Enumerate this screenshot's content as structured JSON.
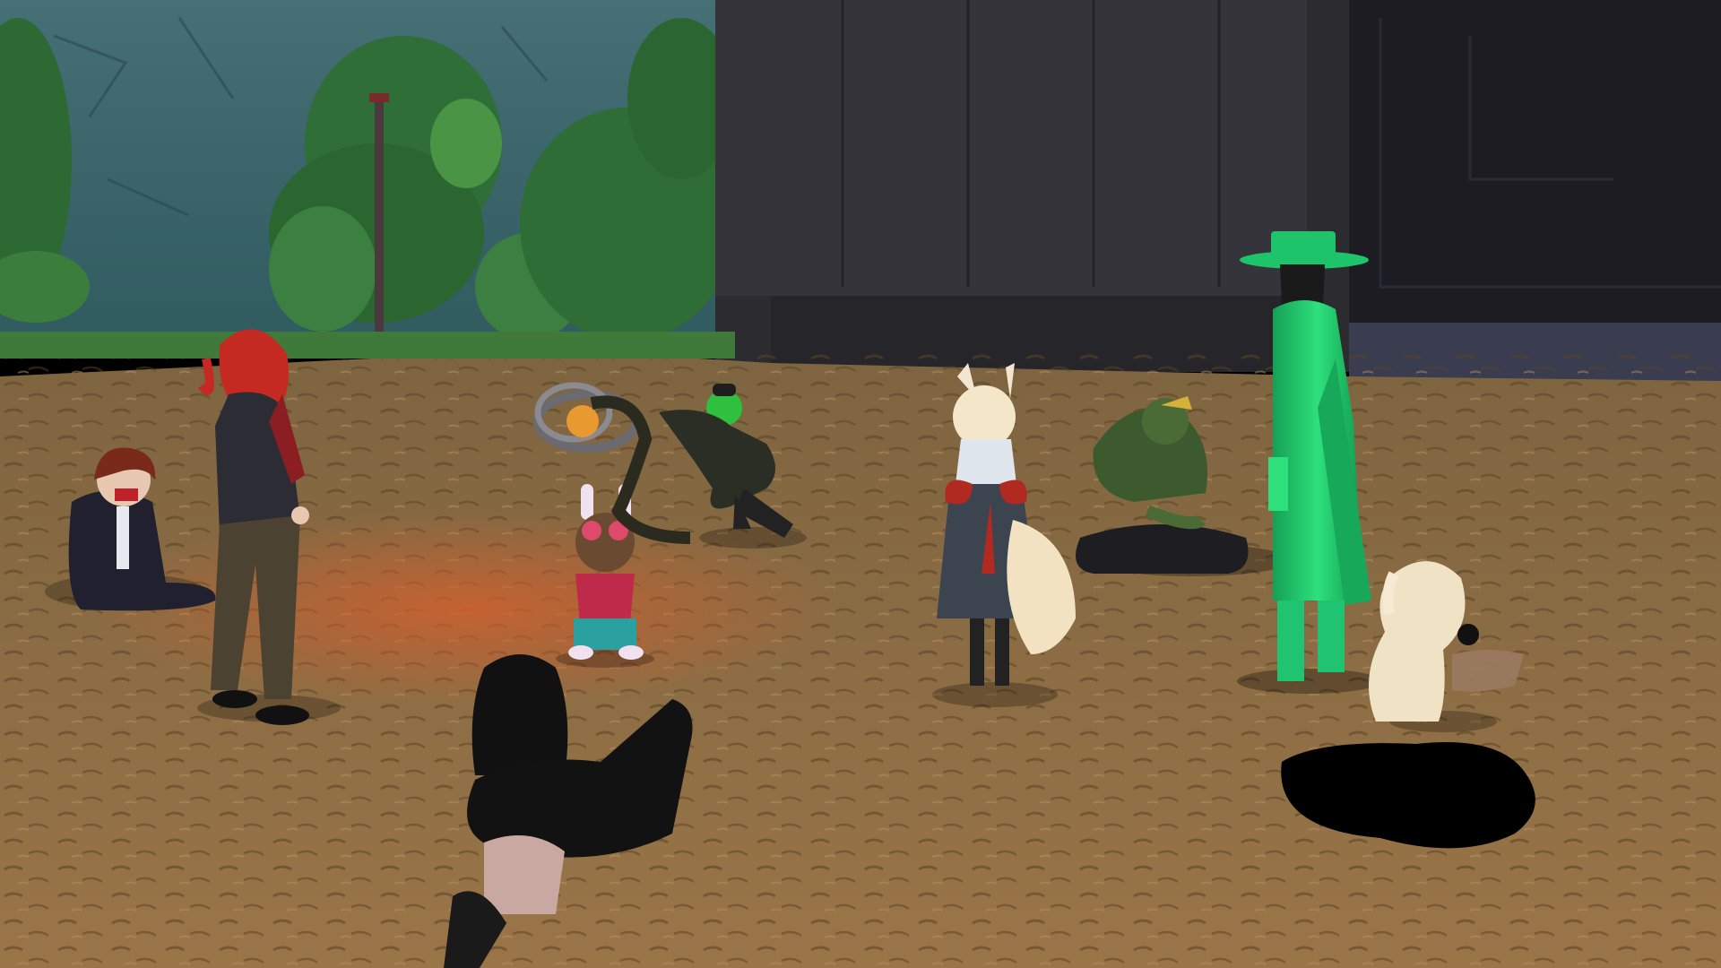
{
  "scene": {
    "description_free": true,
    "colors": {
      "sky_rock": "#3d6a72",
      "rock_dark": "#2f5258",
      "foliage": "#2f6a3a",
      "foliage_light": "#4f9a4a",
      "building": "#2b2b30",
      "building_light": "#3a3a40",
      "ground": "#8a6a3e",
      "ground_dark": "#5c4426",
      "glow": "#c0552a",
      "green_avatar": "#22c26a",
      "red_hair": "#c42a22"
    },
    "avatars": [
      {
        "name": "seated-suit-avatar"
      },
      {
        "name": "red-hair-avatar"
      },
      {
        "name": "bunny-goggles-avatar"
      },
      {
        "name": "rings-orb-avatar"
      },
      {
        "name": "green-hair-crouching-avatar"
      },
      {
        "name": "fox-girl-avatar"
      },
      {
        "name": "seated-green-creature-avatar"
      },
      {
        "name": "green-hat-coat-avatar"
      },
      {
        "name": "plush-dog-avatar"
      },
      {
        "name": "seated-black-hair-avatar"
      }
    ]
  }
}
